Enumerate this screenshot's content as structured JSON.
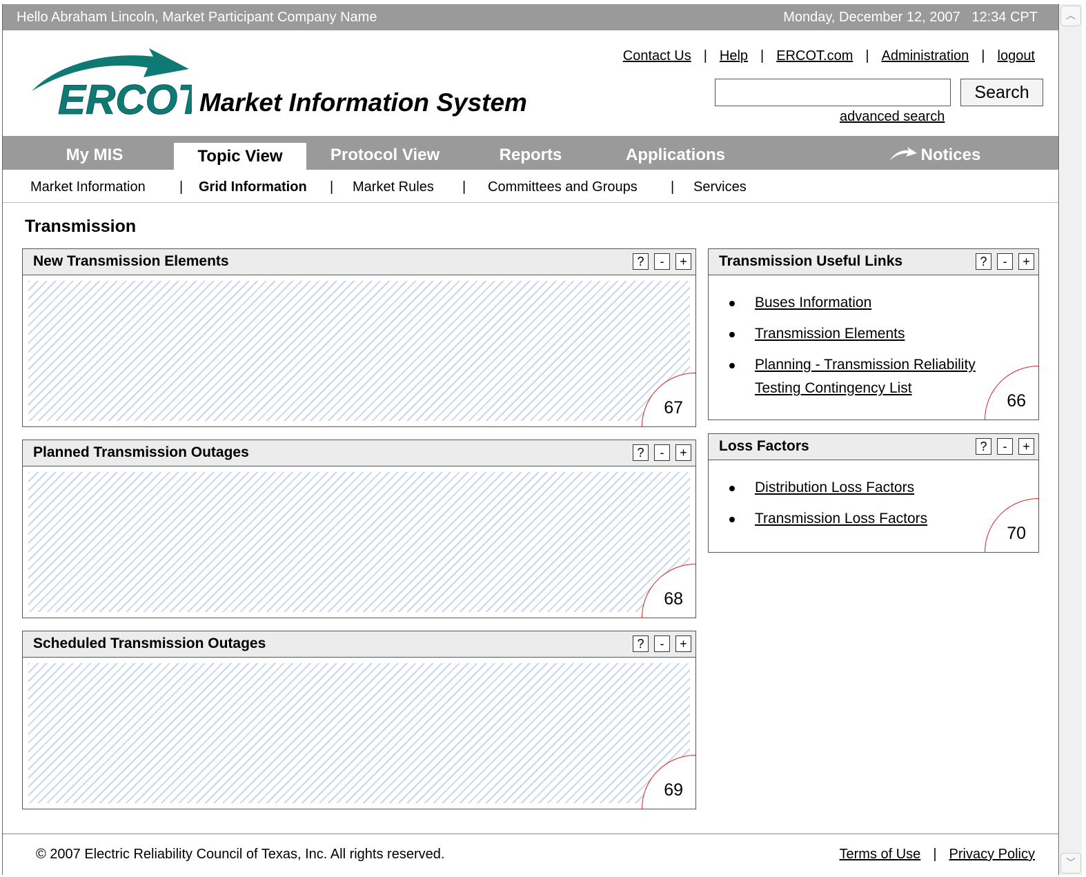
{
  "topbar": {
    "greeting": "Hello Abraham Lincoln, Market Participant Company Name",
    "datetime": "Monday, December 12, 2007   12:34 CPT"
  },
  "header": {
    "logo_text": "ERCOT",
    "app_title": "Market Information System",
    "links": {
      "contact": "Contact Us",
      "help": "Help",
      "ercot": "ERCOT.com",
      "admin": "Administration",
      "logout": "logout"
    },
    "separator": "|",
    "search": {
      "value": "",
      "button": "Search",
      "advanced": "advanced search"
    }
  },
  "nav": {
    "tabs": {
      "my_mis": "My MIS",
      "topic_view": "Topic View",
      "protocol_view": "Protocol View",
      "reports": "Reports",
      "applications": "Applications",
      "notices": "Notices"
    },
    "active_tab": "Topic View"
  },
  "subnav": {
    "market_information": "Market Information",
    "grid_information": "Grid Information",
    "market_rules": "Market Rules",
    "committees": "Committees and Groups",
    "services": "Services"
  },
  "page": {
    "title": "Transmission"
  },
  "controls": {
    "help": "?",
    "minimize": "-",
    "maximize": "+"
  },
  "portlets": {
    "new_elements": {
      "title": "New Transmission Elements",
      "badge": "67"
    },
    "planned_outages": {
      "title": "Planned Transmission Outages",
      "badge": "68"
    },
    "scheduled_outages": {
      "title": "Scheduled Transmission Outages",
      "badge": "69"
    },
    "useful_links": {
      "title": "Transmission Useful Links",
      "badge": "66",
      "items": [
        "Buses Information",
        "Transmission Elements",
        "Planning - Transmission Reliability Testing Contingency List"
      ]
    },
    "loss_factors": {
      "title": "Loss Factors",
      "badge": "70",
      "items": [
        "Distribution Loss Factors",
        "Transmission Loss Factors"
      ]
    }
  },
  "footer": {
    "copyright": "© 2007 Electric Reliability Council of Texas, Inc.  All rights reserved.",
    "terms": "Terms of Use",
    "privacy": "Privacy Policy"
  },
  "colors": {
    "bar_gray": "#9a9a9a",
    "logo_teal": "#0f7a74",
    "badge_red": "#e02020",
    "hatch_blue": "#c8d6ec"
  }
}
